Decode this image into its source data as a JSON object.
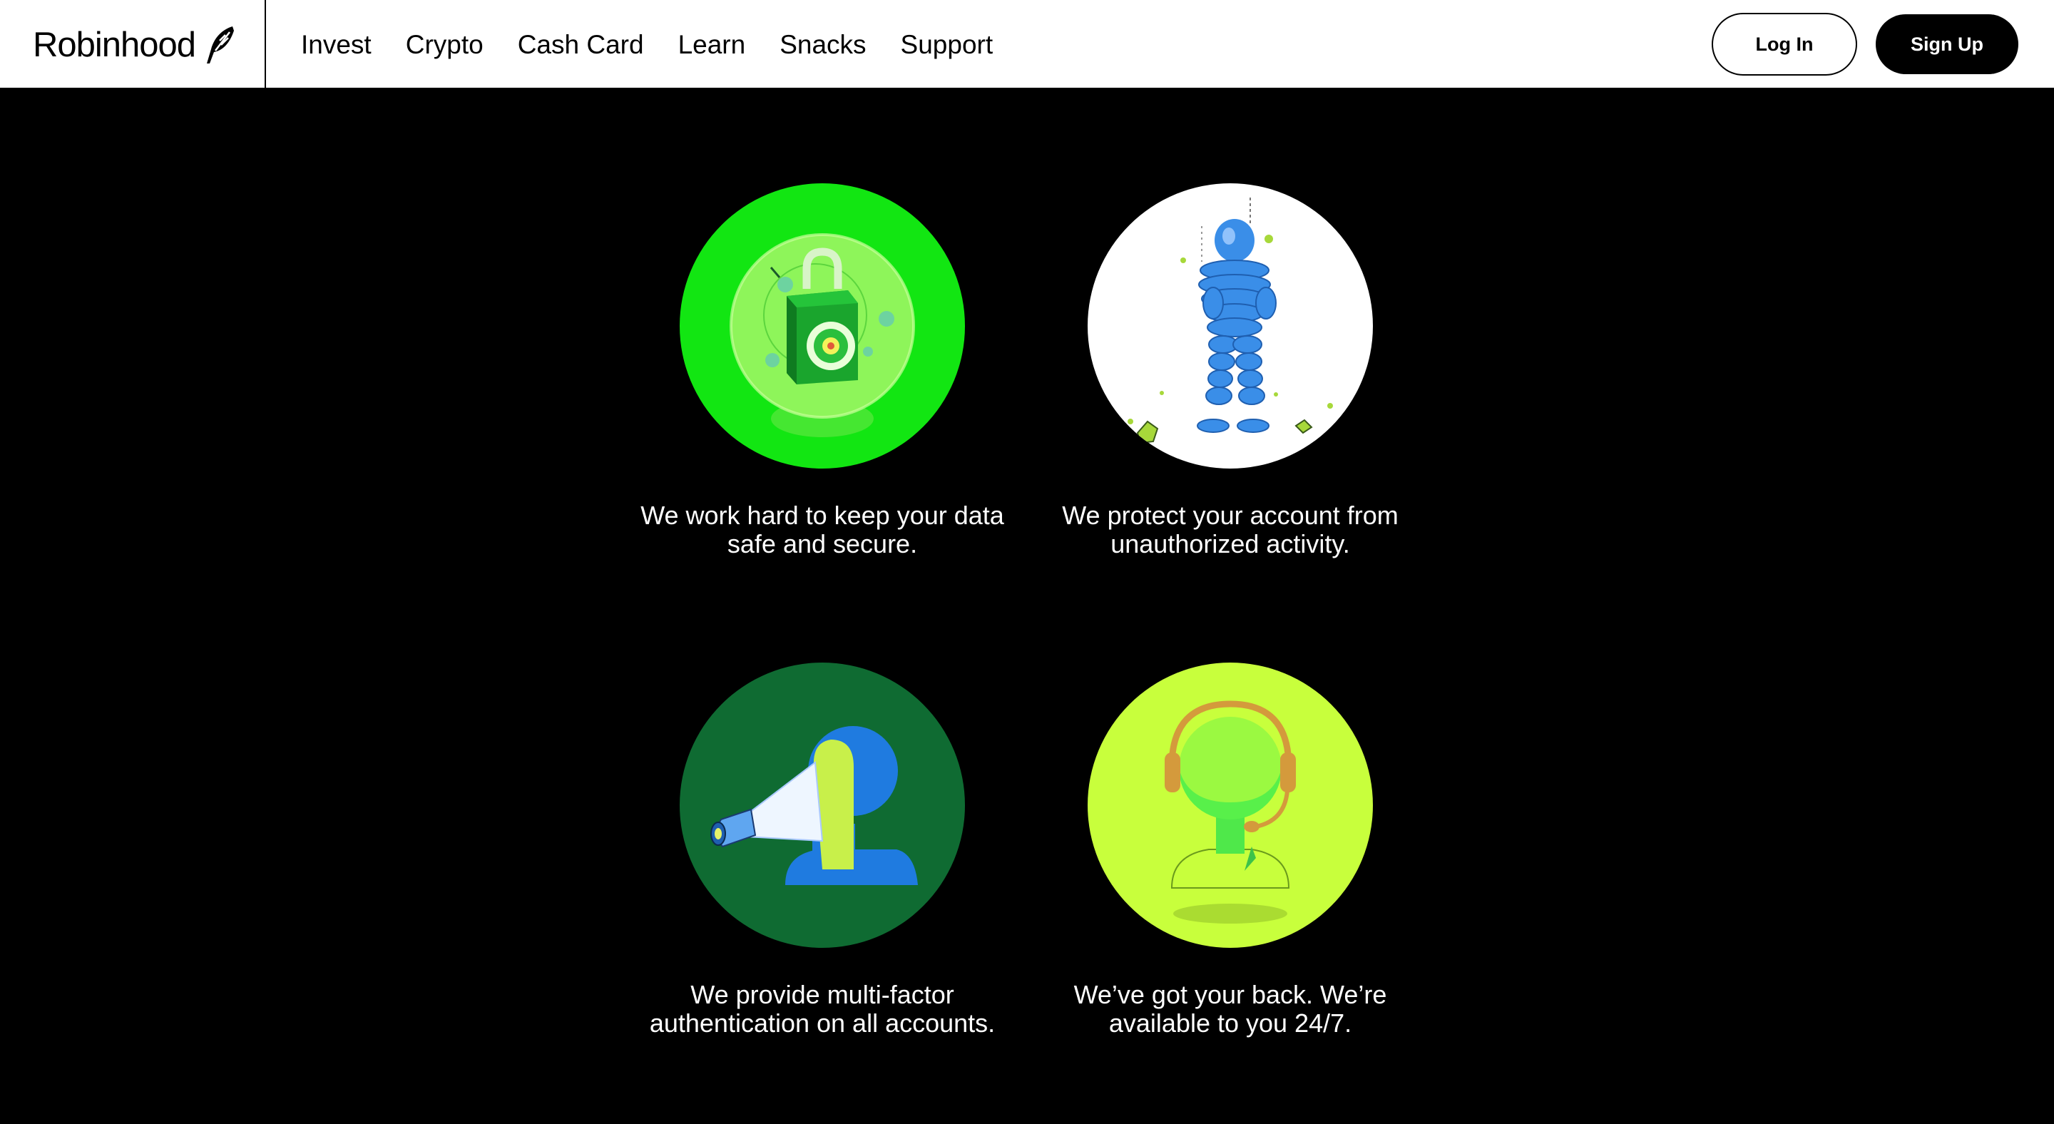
{
  "brand": {
    "name": "Robinhood",
    "icon": "feather-icon"
  },
  "nav": {
    "links": [
      "Invest",
      "Crypto",
      "Cash Card",
      "Learn",
      "Snacks",
      "Support"
    ],
    "login_label": "Log In",
    "signup_label": "Sign Up"
  },
  "features": [
    {
      "icon": "lock-globe-icon",
      "bg": "#12e612",
      "caption_line1": "We work hard to keep your data",
      "caption_line2": "safe and secure."
    },
    {
      "icon": "armored-figure-icon",
      "bg": "#ffffff",
      "caption_line1": "We protect your account from",
      "caption_line2": "unauthorized activity."
    },
    {
      "icon": "flashlight-head-icon",
      "bg": "#0f6b32",
      "caption_line1": "We provide multi-factor",
      "caption_line2": "authentication on all accounts."
    },
    {
      "icon": "headset-agent-icon",
      "bg": "#c8ff3c",
      "caption_line1": "We’ve got your back. We’re",
      "caption_line2": "available to you 24/7."
    }
  ]
}
